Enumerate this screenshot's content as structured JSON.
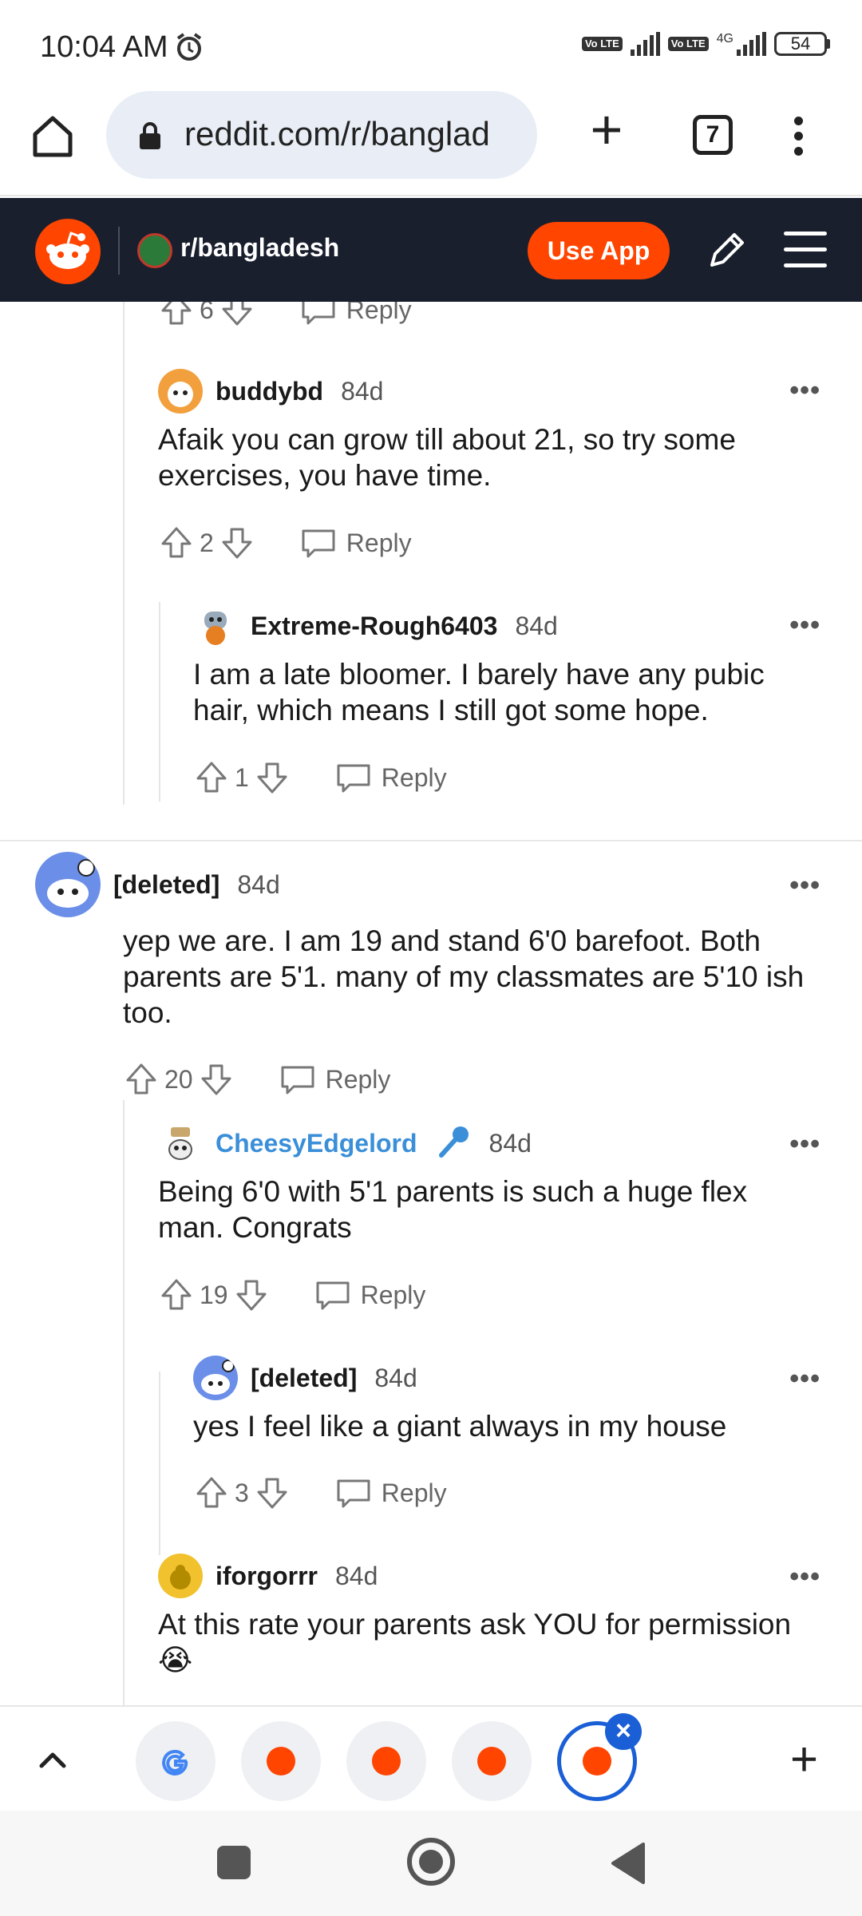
{
  "status_bar": {
    "time": "10:04 AM",
    "volte_1": "Vo LTE",
    "volte_2": "Vo LTE",
    "network": "4G",
    "battery": "54"
  },
  "browser": {
    "url": "reddit.com/r/banglad",
    "tab_count": "7"
  },
  "reddit_header": {
    "subreddit": "r/bangladesh",
    "use_app_label": "Use App"
  },
  "comments": [
    {
      "id": "prev",
      "upvotes": "6",
      "reply_label": "Reply"
    },
    {
      "id": "buddybd",
      "username": "buddybd",
      "age": "84d",
      "text": "Afaik you can grow till about 21, so try some exercises, you have time.",
      "upvotes": "2",
      "reply_label": "Reply"
    },
    {
      "id": "extreme",
      "username": "Extreme-Rough6403",
      "age": "84d",
      "text": "I am a late bloomer. I barely have any pubic hair, which means I still got some hope.",
      "upvotes": "1",
      "reply_label": "Reply"
    },
    {
      "id": "deleted1",
      "username": "[deleted]",
      "age": "84d",
      "text": "yep we are. I am 19 and stand 6'0 barefoot. Both parents are 5'1. many of my classmates are 5'10 ish too.",
      "upvotes": "20",
      "reply_label": "Reply"
    },
    {
      "id": "cheesy",
      "username": "CheesyEdgelord",
      "age": "84d",
      "text": "Being 6'0 with 5'1 parents is such a huge flex man. Congrats",
      "upvotes": "19",
      "reply_label": "Reply"
    },
    {
      "id": "deleted2",
      "username": "[deleted]",
      "age": "84d",
      "text": "yes I feel like a giant always in my house",
      "upvotes": "3",
      "reply_label": "Reply"
    },
    {
      "id": "iforgorrr",
      "username": "iforgorrr",
      "age": "84d",
      "text": "At this rate your parents ask YOU for permission 😭"
    }
  ],
  "more_label": "•••",
  "colors": {
    "reddit_orange": "#ff4500",
    "header_bg": "#1a1f2e",
    "mod_blue": "#3a8fd8",
    "active_tab": "#1a5fd6"
  }
}
